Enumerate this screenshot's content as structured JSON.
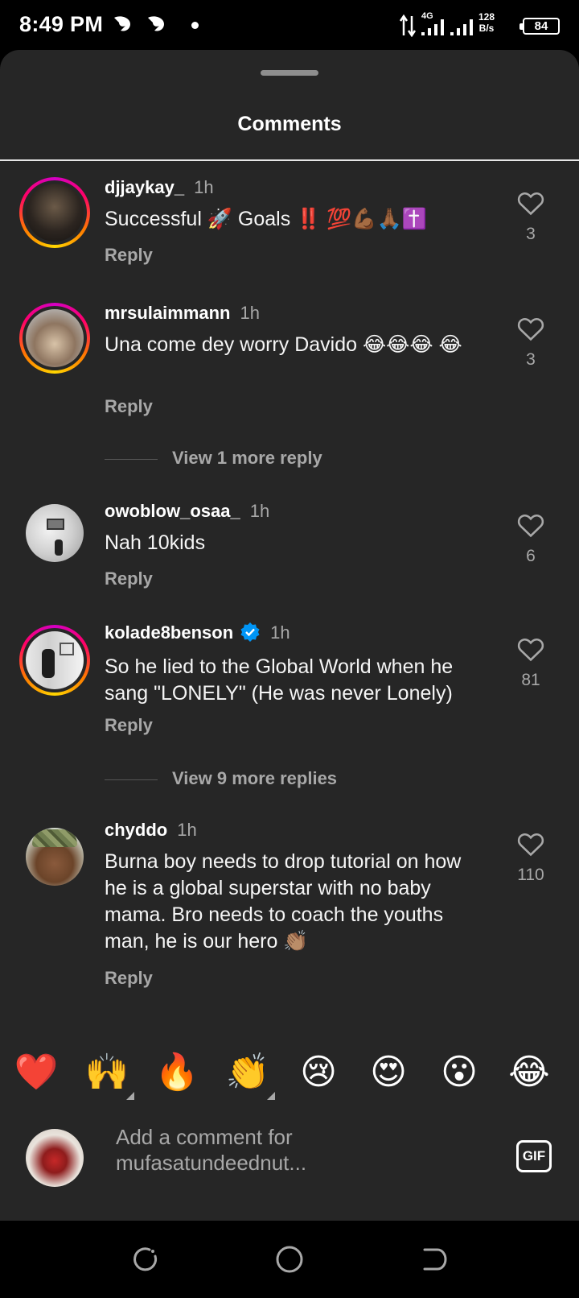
{
  "status_bar": {
    "time": "8:49 PM",
    "network": "4G",
    "speed_value": "128",
    "speed_unit": "B/s",
    "battery": "84"
  },
  "sheet": {
    "title": "Comments"
  },
  "comments": [
    {
      "username": "djjaykay_",
      "time": "1h",
      "text": "Successful 🚀 Goals ‼️ 💯💪🏾🙏🏾✝️",
      "reply_label": "Reply",
      "likes": "3",
      "verified": false,
      "story_ring": true
    },
    {
      "username": "mrsulaimmann",
      "time": "1h",
      "text": "Una come dey worry Davido 😂😂😂 😂",
      "reply_label": "Reply",
      "likes": "3",
      "verified": false,
      "story_ring": true
    },
    {
      "username": "owoblow_osaa_",
      "time": "1h",
      "text": "Nah 10kids",
      "reply_label": "Reply",
      "likes": "6",
      "verified": false,
      "story_ring": false
    },
    {
      "username": "kolade8benson",
      "time": "1h",
      "text": "So he lied to the Global World when he sang \"LONELY\" (He was never Lonely)",
      "reply_label": "Reply",
      "likes": "81",
      "verified": true,
      "story_ring": true
    },
    {
      "username": "chyddo",
      "time": "1h",
      "text": "Burna boy needs to drop tutorial on how he is a global superstar with no baby mama. Bro needs to coach the youths man, he is our hero 👏🏽",
      "reply_label": "Reply",
      "likes": "110",
      "verified": false,
      "story_ring": false
    }
  ],
  "view_more": [
    "View 1 more reply",
    "View 9 more replies"
  ],
  "reactions": [
    "❤️",
    "🙌",
    "🔥",
    "👏",
    "😢",
    "😍",
    "😮",
    "😂"
  ],
  "composer": {
    "placeholder": "Add a comment for mufasatundeednut...",
    "gif_label": "GIF"
  },
  "colors": {
    "sheet_bg": "#262626",
    "secondary_text": "#a8a8a8",
    "verified_blue": "#0095f6"
  },
  "icons": {
    "like": "heart-outline-icon",
    "verified": "verified-badge-icon",
    "nav_recents": "recents-icon",
    "nav_home": "home-circle-icon",
    "nav_back": "back-icon"
  }
}
